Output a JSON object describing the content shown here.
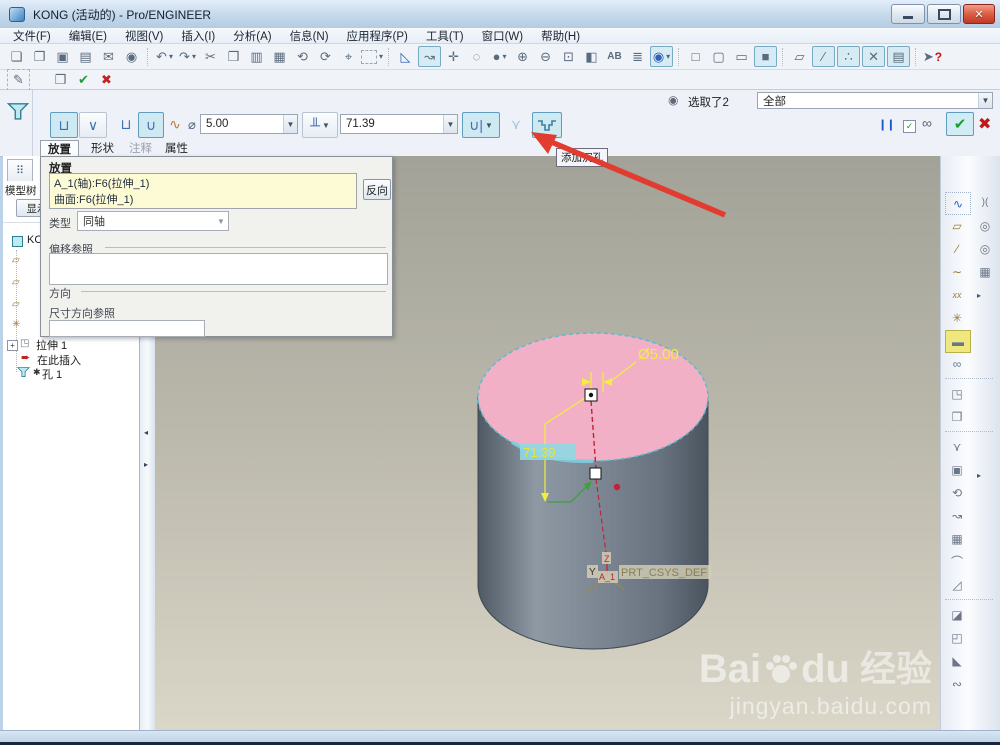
{
  "window": {
    "title": "KONG (活动的) - Pro/ENGINEER"
  },
  "menubar": {
    "items": [
      "文件(F)",
      "编辑(E)",
      "视图(V)",
      "插入(I)",
      "分析(A)",
      "信息(N)",
      "应用程序(P)",
      "工具(T)",
      "窗口(W)",
      "帮助(H)"
    ]
  },
  "toolbar1": {
    "glyphs": [
      "❏",
      "❐",
      "▣",
      "▤",
      "✉",
      "◉",
      "↶",
      "↷",
      "✂",
      "❒",
      "▥",
      "▦",
      "⟲",
      "⟳",
      "⌖",
      "",
      "◺",
      "↝",
      "✛",
      "◌",
      "●",
      "⊕",
      "⊖",
      "⊡",
      "◧",
      "AB",
      "≣",
      "◉",
      "□",
      "▢",
      "▭",
      "■",
      "▱",
      "∕",
      "∴",
      "✕",
      "▤"
    ],
    "help_arrow": "➤",
    "help_q": "?"
  },
  "toolbar2": {
    "glyphs": [
      "✎",
      "❒",
      "✔",
      "✖"
    ]
  },
  "selection": {
    "icon": "◉",
    "label": "选取了2",
    "filter": "全部"
  },
  "dashboard": {
    "simple_hole": "⊔",
    "standard_hole": "∨",
    "profile_rect": "⊔",
    "profile_round": "∪",
    "sketch": "∿",
    "dia_symbol": "⌀",
    "diameter": "5.00",
    "depth_btn": "╨",
    "depth": "71.39",
    "direction": "∪|",
    "countersink": "⋎",
    "tooltip": "添加沉孔",
    "pause": "❙❙",
    "check": "✓",
    "glasses": "∞",
    "confirm": "✔",
    "cancel": "✖",
    "tabs": [
      "放置",
      "形状",
      "注释",
      "属性"
    ]
  },
  "panel": {
    "title": "放置",
    "refs": [
      "A_1(轴):F6(拉伸_1)",
      "曲面:F6(拉伸_1)"
    ],
    "flip": "反向",
    "type_label": "类型",
    "type_value": "同轴",
    "offset_label": "偏移参照",
    "orient_label": "方向",
    "dimref_label": "尺寸方向参照"
  },
  "navigator": {
    "tab_icon": "⠿",
    "header": "模型树",
    "show": "显示",
    "part": "KC",
    "mini": [
      "▱",
      "▱",
      "▱",
      "✳"
    ],
    "tree": {
      "expander": "+",
      "extrude": "拉伸 1",
      "insert_arrow": "➨",
      "insert_here": "在此插入",
      "flag": "✱",
      "hole": "孔 1"
    }
  },
  "viewport": {
    "dim_diameter": "Ø5.00",
    "dim_depth": "71.39",
    "csys": "PRT_CSYS_DEF",
    "axis": "A_1",
    "y_label": "Y",
    "z_label": "Z"
  },
  "watermark": {
    "b1": "Bai",
    "b2": "du",
    "suffix": "经验",
    "url": "jingyan.baidu.com"
  },
  "right_toolbar": {
    "colA": [
      "∿",
      "▱",
      "∕",
      "∼",
      "xx",
      "✳",
      "▬",
      "∞",
      "◳",
      "❐",
      "⋎",
      "▣",
      "⟲",
      "↝",
      "▦",
      "⌒",
      "◿",
      "◪",
      "◰",
      "◣",
      "∾"
    ],
    "colB": [
      ")(",
      "◎",
      "◎",
      "▦"
    ],
    "flyout": "▸"
  },
  "splitter": {
    "left": "◂",
    "right": "▸"
  },
  "colors": {
    "accent_cyan": "#7fd0e0",
    "face_pink": "#f1b0c5",
    "dim_yellow": "#f2ee3e",
    "arrow_red": "#e23c30",
    "highlight_cyan": "#8fd8e3"
  }
}
